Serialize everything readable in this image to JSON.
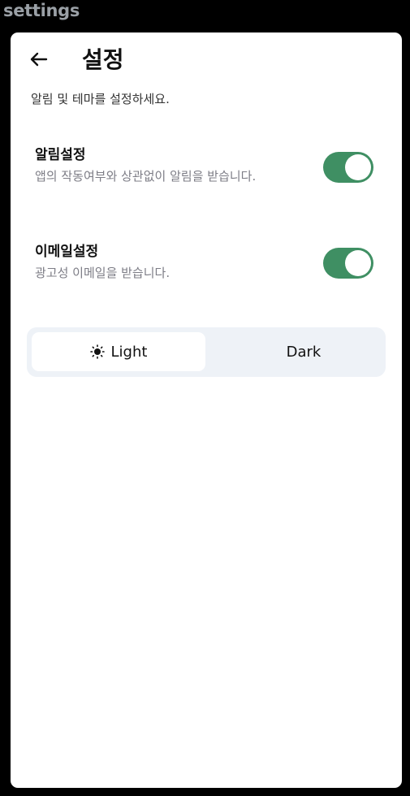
{
  "app": {
    "label": "settings"
  },
  "header": {
    "title": "설정",
    "back_icon": "arrow-left-icon"
  },
  "description": "알림 및 테마를 설정하세요.",
  "settings": [
    {
      "title": "알림설정",
      "description": "앱의 작동여부와 상관없이 알림을 받습니다.",
      "enabled": true
    },
    {
      "title": "이메일설정",
      "description": "광고성 이메일을 받습니다.",
      "enabled": true
    }
  ],
  "theme": {
    "selected": "Light",
    "options": [
      {
        "label": "Light",
        "icon": "sun-icon"
      },
      {
        "label": "Dark",
        "icon": "moon-icon"
      }
    ]
  },
  "colors": {
    "toggle_on": "#3f8f63",
    "theme_track": "#eef2f7",
    "app_label": "#9aa0a6"
  }
}
